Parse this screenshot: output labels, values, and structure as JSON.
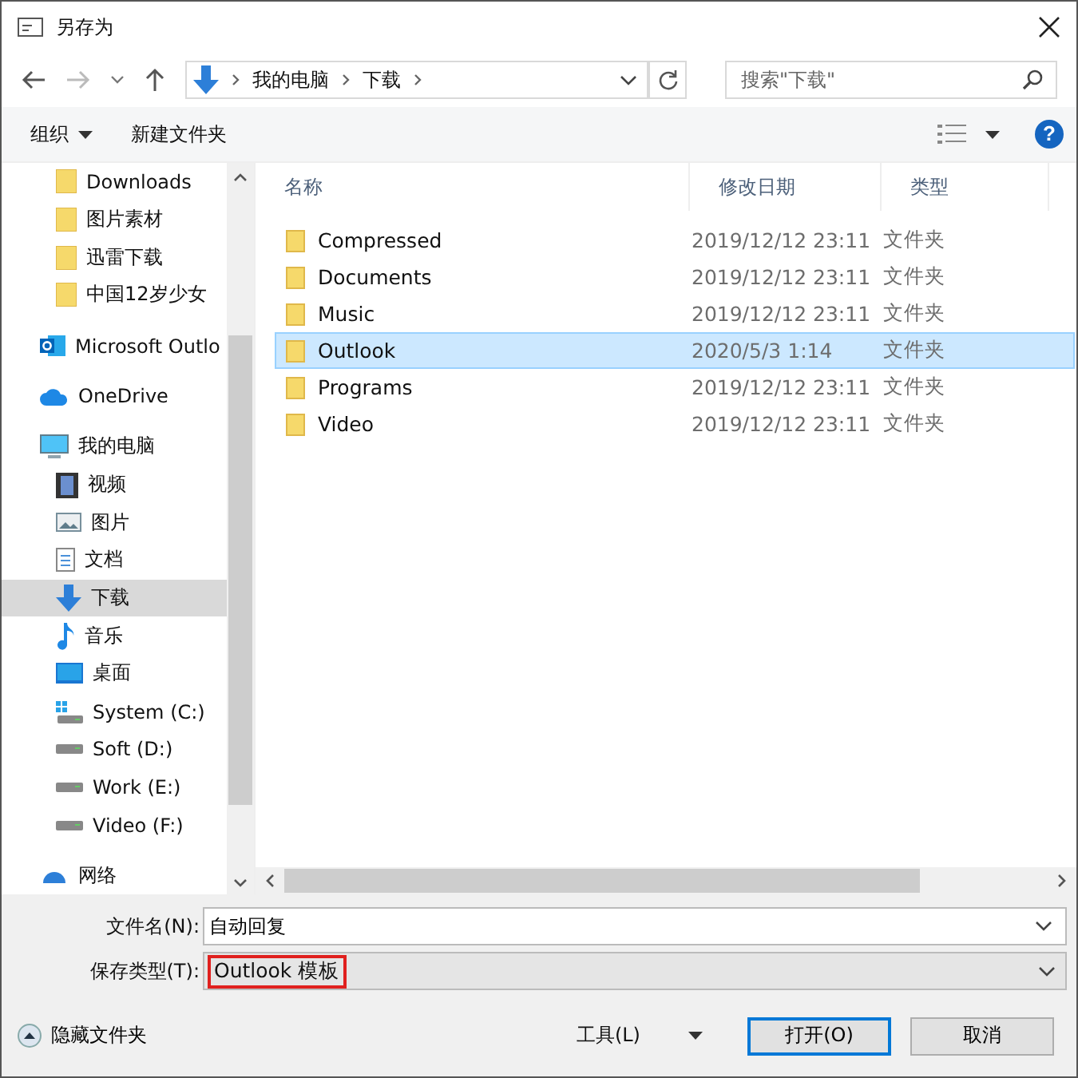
{
  "window": {
    "title": "另存为"
  },
  "address": {
    "crumbs": [
      "我的电脑",
      "下载"
    ],
    "search_placeholder": "搜索\"下载\""
  },
  "toolbar": {
    "organize": "组织",
    "new_folder": "新建文件夹",
    "help": "?"
  },
  "quick_access": [
    {
      "label": "Downloads",
      "selected": false
    },
    {
      "label": "图片素材",
      "selected": false
    },
    {
      "label": "迅雷下载",
      "selected": false
    },
    {
      "label": "中国12岁少女",
      "selected": false
    }
  ],
  "sidebar": [
    {
      "kind": "outlook",
      "label": "Microsoft Outlo",
      "selected": false
    },
    {
      "kind": "onedrive",
      "label": "OneDrive",
      "selected": false
    },
    {
      "kind": "pc",
      "label": "我的电脑",
      "selected": false,
      "children": [
        {
          "kind": "video",
          "label": "视频",
          "selected": false
        },
        {
          "kind": "pictures",
          "label": "图片",
          "selected": false
        },
        {
          "kind": "docs",
          "label": "文档",
          "selected": false
        },
        {
          "kind": "download",
          "label": "下载",
          "selected": true
        },
        {
          "kind": "music",
          "label": "音乐",
          "selected": false
        },
        {
          "kind": "desktop",
          "label": "桌面",
          "selected": false
        },
        {
          "kind": "system-drive",
          "label": "System (C:)",
          "selected": false
        },
        {
          "kind": "drive",
          "label": "Soft (D:)",
          "selected": false
        },
        {
          "kind": "drive",
          "label": "Work (E:)",
          "selected": false
        },
        {
          "kind": "drive",
          "label": "Video (F:)",
          "selected": false
        }
      ]
    },
    {
      "kind": "network",
      "label": "网络",
      "selected": false
    }
  ],
  "table": {
    "columns": [
      "名称",
      "修改日期",
      "类型"
    ],
    "rows": [
      {
        "name": "Compressed",
        "date": "2019/12/12 23:11",
        "type": "文件夹",
        "selected": false
      },
      {
        "name": "Documents",
        "date": "2019/12/12 23:11",
        "type": "文件夹",
        "selected": false
      },
      {
        "name": "Music",
        "date": "2019/12/12 23:11",
        "type": "文件夹",
        "selected": false
      },
      {
        "name": "Outlook",
        "date": "2020/5/3 1:14",
        "type": "文件夹",
        "selected": true
      },
      {
        "name": "Programs",
        "date": "2019/12/12 23:11",
        "type": "文件夹",
        "selected": false
      },
      {
        "name": "Video",
        "date": "2019/12/12 23:11",
        "type": "文件夹",
        "selected": false
      }
    ]
  },
  "form": {
    "filename_label": "文件名(N):",
    "filename": "自动回复",
    "type_label": "保存类型(T):",
    "type": "Outlook 模板"
  },
  "footer": {
    "hide_folders": "隐藏文件夹",
    "tools": "工具(L)",
    "save": "打开(O)",
    "cancel": "取消"
  }
}
